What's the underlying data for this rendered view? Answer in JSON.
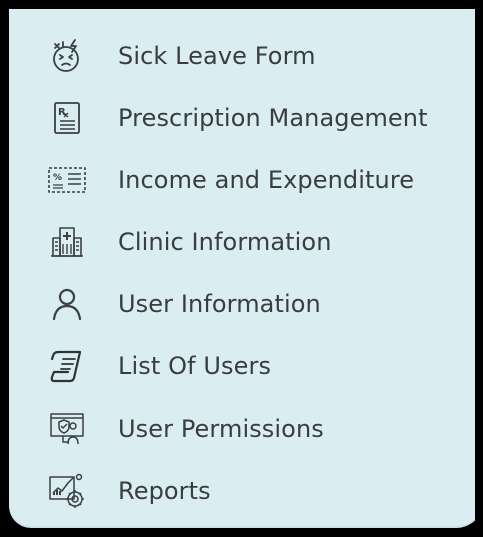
{
  "menu": {
    "items": [
      {
        "label": "Sick Leave Form",
        "icon": "sick-face-icon"
      },
      {
        "label": "Prescription Management",
        "icon": "prescription-icon"
      },
      {
        "label": "Income and Expenditure",
        "icon": "income-expenditure-icon"
      },
      {
        "label": "Clinic Information",
        "icon": "clinic-building-icon"
      },
      {
        "label": "User Information",
        "icon": "user-icon"
      },
      {
        "label": "List Of Users",
        "icon": "user-list-icon"
      },
      {
        "label": "User Permissions",
        "icon": "user-permissions-icon"
      },
      {
        "label": "Reports",
        "icon": "reports-icon"
      }
    ]
  },
  "colors": {
    "panel_background": "#daeef2",
    "text": "#3a3d3f",
    "icon": "#3b3f42",
    "frame": "#000000"
  }
}
